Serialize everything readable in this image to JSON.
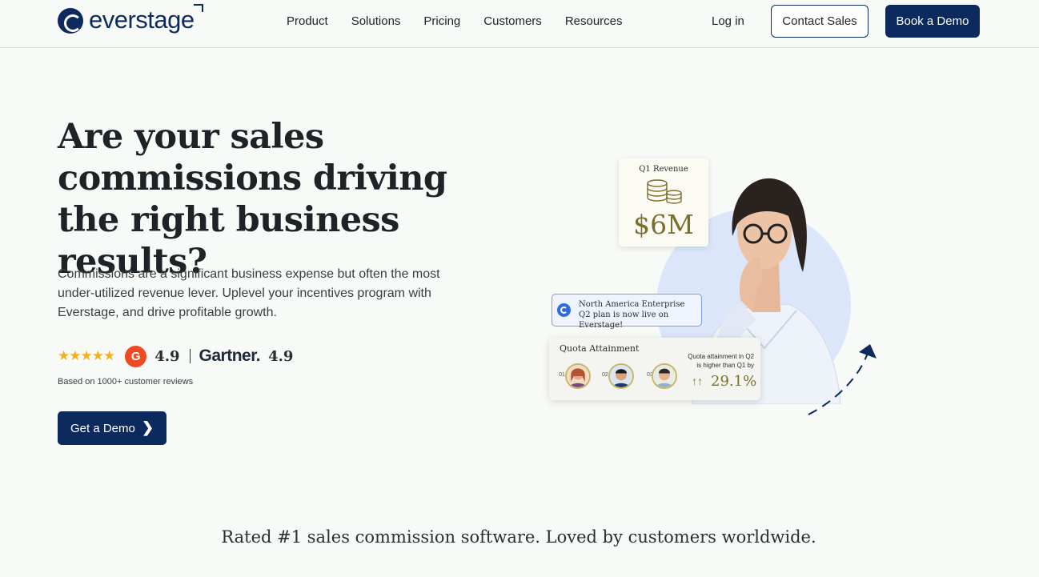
{
  "brand": {
    "name": "everstage",
    "color": "#0d2a5e"
  },
  "nav": {
    "items": [
      "Product",
      "Solutions",
      "Pricing",
      "Customers",
      "Resources"
    ],
    "login": "Log in",
    "contact_sales": "Contact Sales",
    "book_demo": "Book a Demo"
  },
  "hero": {
    "title": "Are your sales commissions driving the right business results?",
    "subtitle": "Commissions are a significant business expense but often the most under-utilized revenue lever. Uplevel your incentives program with Everstage, and drive profitable growth.",
    "stars": "★★★★★",
    "rating_stars": 4.5,
    "g2_logo": "G",
    "g2_score": "4.9",
    "gartner_label": "Gartner.",
    "gartner_score": "4.9",
    "reviews_note": "Based on 1000+ customer reviews",
    "cta_label": "Get a Demo",
    "cta_icon": "chevron-right-icon"
  },
  "illustration": {
    "revenue_label": "Q1 Revenue",
    "revenue_value": "$6M",
    "notification": "North America Enterprise Q2 plan is now live on Everstage!",
    "quota_title": "Quota Attainment",
    "quota_labels": [
      "01",
      "02",
      "03"
    ],
    "quota_note": "Quota attainment in Q2 is higher than Q1 by",
    "quota_arrows": "↑↑",
    "quota_value": "29.1%"
  },
  "tagline": "Rated #1 sales commission software.  Loved by customers worldwide."
}
